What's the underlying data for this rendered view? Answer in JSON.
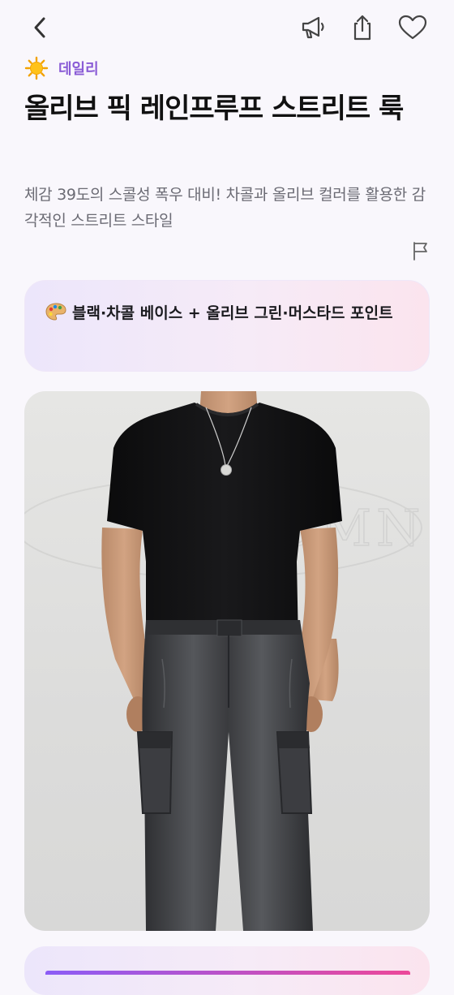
{
  "header": {
    "back_icon": "chevron-left-icon",
    "actions": [
      "megaphone-icon",
      "share-icon",
      "heart-icon"
    ]
  },
  "category": {
    "icon": "sun-icon",
    "label": "데일리",
    "color": "#8a5cd6"
  },
  "post": {
    "title": "올리브 픽 레인프루프 스트리트 룩",
    "subtitle": "체감 39도의 스콜성 폭우 대비! 차콜과 올리브 컬러를 활용한 감각적인 스트리트 스타일",
    "report_icon": "flag-icon"
  },
  "palette": {
    "icon": "palette-icon",
    "text": "블랙·차콜 베이스 + 올리브 그린·머스타드 포인트"
  },
  "photo": {
    "description_icon": "outfit-photo",
    "watermark": "AUTUMN"
  },
  "colors": {
    "background": "#f9f7fc",
    "accent": "#8a5cd6",
    "card_gradient_start": "#ece6fb",
    "card_gradient_end": "#fbe4ee"
  }
}
